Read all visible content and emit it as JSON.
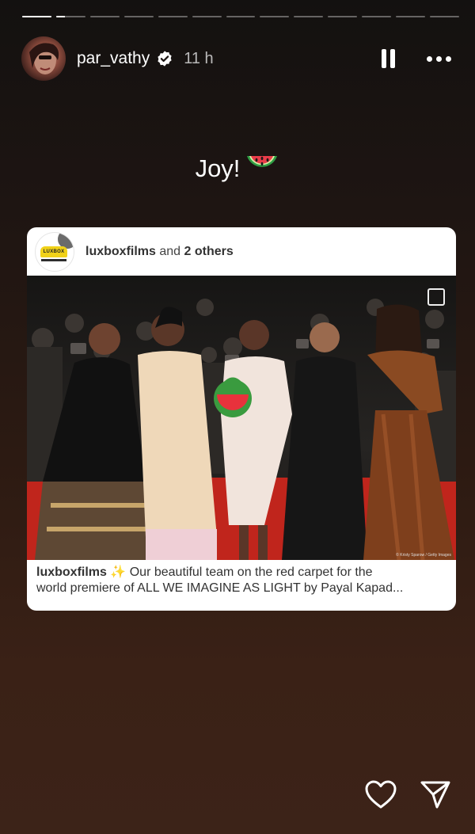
{
  "story": {
    "segments": [
      1,
      0.3,
      0,
      0,
      0,
      0,
      0,
      0,
      0,
      0,
      0,
      0,
      0
    ],
    "username": "par_vathy",
    "verified": true,
    "time": "11 h",
    "caption": "Joy!",
    "caption_emoji": "watermelon"
  },
  "shared_post": {
    "accounts_line": {
      "account": "luxboxfilms",
      "and": "and",
      "others": "2 others"
    },
    "avatar_logo_text": "LUXBOX",
    "image_credit": "© Kristy Sparow / Getty Images",
    "caption_account": "luxboxfilms",
    "caption_emoji": "sparkles",
    "caption_line1": "Our beautiful team on the red carpet for the",
    "caption_line2": "world premiere of ALL WE IMAGINE AS LIGHT by Payal Kapad..."
  },
  "icons": [
    "verified-badge-icon",
    "pause-icon",
    "more-options-icon",
    "watermelon-icon",
    "multi-image-icon",
    "heart-icon",
    "send-icon"
  ]
}
